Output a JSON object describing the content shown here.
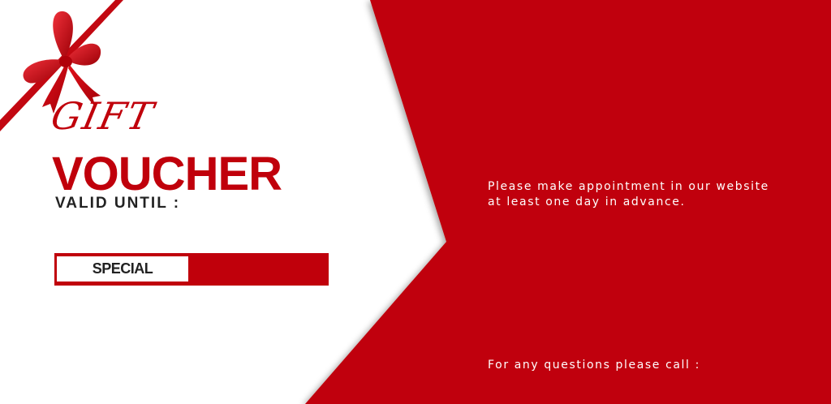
{
  "voucher": {
    "gift_label": "GIFT",
    "voucher_label": "VOUCHER",
    "valid_until_label": "VALID UNTIL :",
    "special_label": "SPECIAL",
    "info_line_1": "Please make appointment in our website",
    "info_line_2": "at least one day in advance.",
    "call_label": "For any questions please call :"
  },
  "colors": {
    "accent_red": "#c0000b",
    "background": "#ffffff",
    "text_dark": "#222222",
    "text_light": "#ffffff"
  },
  "icons": {
    "ribbon": "red-ribbon-bow-icon"
  }
}
